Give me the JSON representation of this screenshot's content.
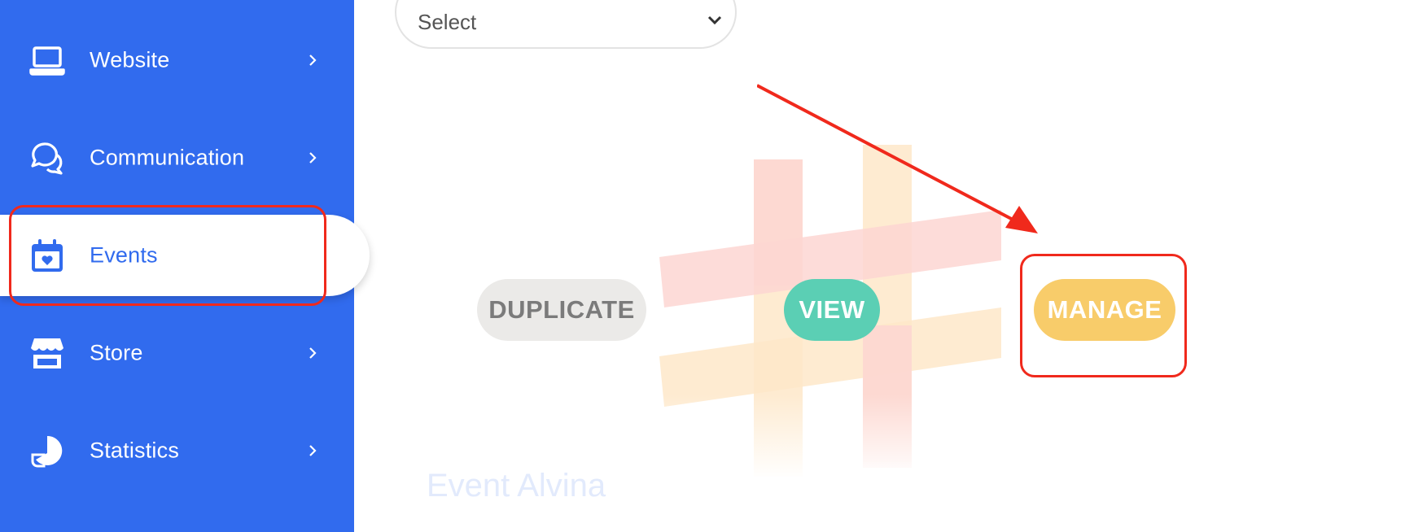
{
  "sidebar": {
    "items": [
      {
        "label": "Website",
        "icon": "laptop-icon"
      },
      {
        "label": "Communication",
        "icon": "chat-bubbles-icon"
      },
      {
        "label": "Events",
        "icon": "calendar-heart-icon",
        "active": true
      },
      {
        "label": "Store",
        "icon": "storefront-icon"
      },
      {
        "label": "Statistics",
        "icon": "pie-chart-icon"
      }
    ]
  },
  "main": {
    "select": {
      "value": "Select"
    },
    "buttons": {
      "duplicate": "DUPLICATE",
      "view": "VIEW",
      "manage": "MANAGE"
    },
    "event_title": "Event Alvina"
  },
  "colors": {
    "sidebar_bg": "#316bee",
    "duplicate_bg": "#ebeae8",
    "view_bg": "#5bcfb4",
    "manage_bg": "#f8cc6a",
    "annotation": "#f0291c"
  }
}
